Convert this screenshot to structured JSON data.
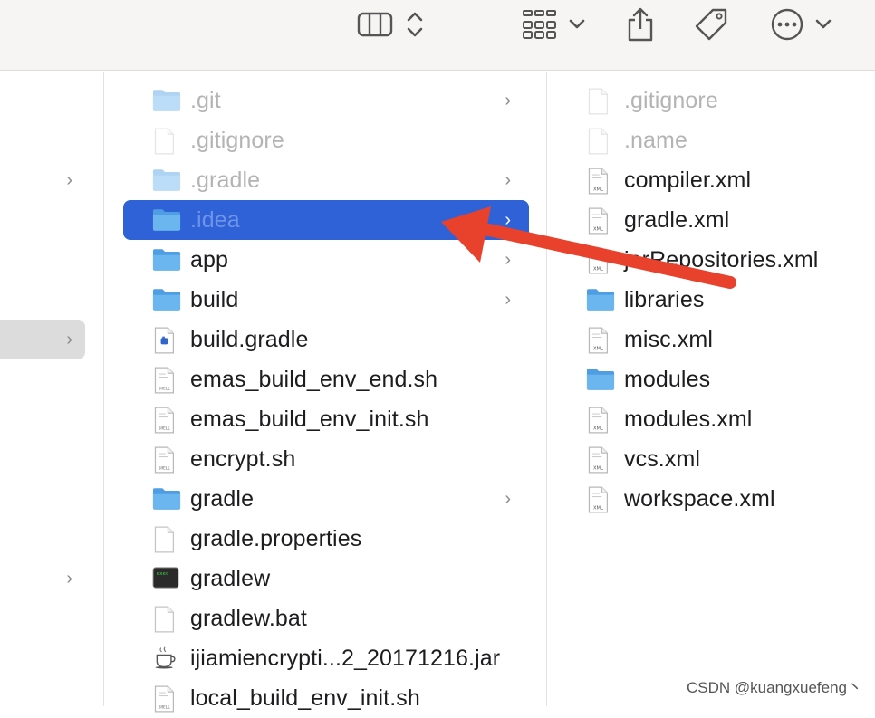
{
  "toolbar": {
    "icons": [
      "column-view-icon",
      "view-options-chevrons-icon",
      "group-grid-icon",
      "share-icon",
      "tag-icon",
      "more-actions-icon"
    ]
  },
  "column0": {
    "rows": [
      {
        "chevron": "›"
      },
      {
        "chevron": "›"
      },
      {
        "chevron": "›"
      }
    ]
  },
  "column1": {
    "items": [
      {
        "name": ".git",
        "icon": "folder",
        "dim": true,
        "chevron": "›"
      },
      {
        "name": ".gitignore",
        "icon": "doc",
        "dim": true,
        "chevron": ""
      },
      {
        "name": ".gradle",
        "icon": "folder",
        "dim": true,
        "chevron": "›"
      },
      {
        "name": ".idea",
        "icon": "folder",
        "selected": true,
        "chevron": "›"
      },
      {
        "name": "app",
        "icon": "folder",
        "chevron": "›"
      },
      {
        "name": "build",
        "icon": "folder",
        "chevron": "›"
      },
      {
        "name": "build.gradle",
        "icon": "gradle",
        "chevron": ""
      },
      {
        "name": "emas_build_env_end.sh",
        "icon": "shell",
        "chevron": ""
      },
      {
        "name": "emas_build_env_init.sh",
        "icon": "shell",
        "chevron": ""
      },
      {
        "name": "encrypt.sh",
        "icon": "shell",
        "chevron": ""
      },
      {
        "name": "gradle",
        "icon": "folder",
        "chevron": "›"
      },
      {
        "name": "gradle.properties",
        "icon": "doc",
        "chevron": ""
      },
      {
        "name": "gradlew",
        "icon": "terminal",
        "chevron": ""
      },
      {
        "name": "gradlew.bat",
        "icon": "doc",
        "chevron": ""
      },
      {
        "name": "ijiamiencrypti...2_20171216.jar",
        "icon": "jar",
        "chevron": ""
      },
      {
        "name": "local_build_env_init.sh",
        "icon": "shell",
        "chevron": ""
      }
    ]
  },
  "column2": {
    "items": [
      {
        "name": ".gitignore",
        "icon": "doc",
        "dim": true
      },
      {
        "name": ".name",
        "icon": "doc",
        "dim": true
      },
      {
        "name": "compiler.xml",
        "icon": "xml"
      },
      {
        "name": "gradle.xml",
        "icon": "xml"
      },
      {
        "name": "jarRepositories.xml",
        "icon": "xml"
      },
      {
        "name": "libraries",
        "icon": "folder"
      },
      {
        "name": "misc.xml",
        "icon": "xml"
      },
      {
        "name": "modules",
        "icon": "folder"
      },
      {
        "name": "modules.xml",
        "icon": "xml"
      },
      {
        "name": "vcs.xml",
        "icon": "xml"
      },
      {
        "name": "workspace.xml",
        "icon": "xml"
      }
    ]
  },
  "annotation": {
    "color": "#e8412c",
    "target": ".idea"
  },
  "watermark": "CSDN @kuangxuefeng丶",
  "colors": {
    "selection": "#2e62d6",
    "folder": "#5aa9e6"
  }
}
